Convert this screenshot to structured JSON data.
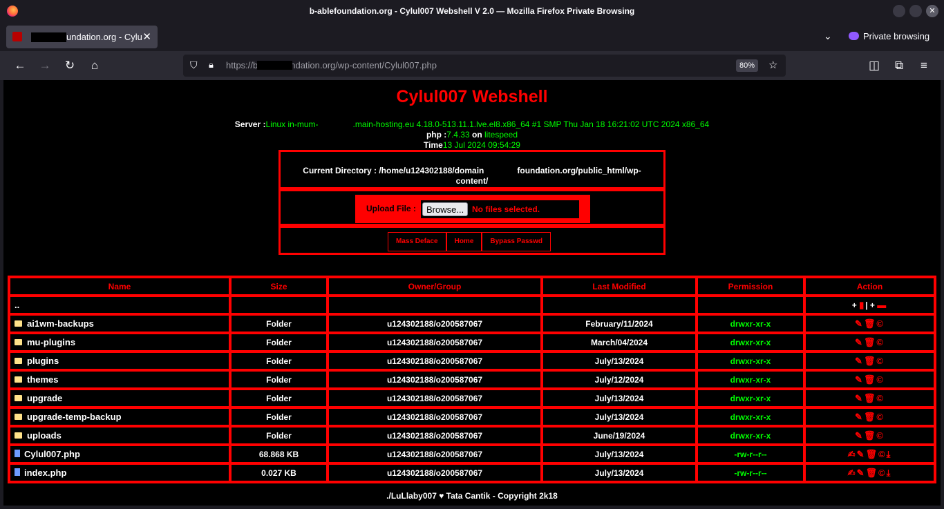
{
  "window": {
    "title": "b-ablefoundation.org - Cylul007 Webshell V 2.0 — Mozilla Firefox Private Browsing"
  },
  "tab": {
    "title": "undation.org - Cylul"
  },
  "tabbar": {
    "private_label": "Private browsing"
  },
  "navbar": {
    "url_prefix": "https://",
    "url_rest": "b-ablefoundation.org/wp-content/Cylul007.php",
    "zoom": "80%"
  },
  "page": {
    "heading": "Cylul007 Webshell",
    "server_label": "Server :",
    "server_part1": "Linux in-mum-",
    "server_part2": ".main-hosting.eu 4.18.0-513.11.1.lve.el8.x86_64 #1 SMP Thu Jan 18 16:21:02 UTC 2024 x86_64",
    "php_label": "php :",
    "php_version": "7.4.33",
    "on_label": " on ",
    "server_software": "litespeed",
    "time_label": "Time",
    "time_value": "13 Jul 2024 09:54:29",
    "curdir_label": "Current Directory : /home/u124302188/domain",
    "curdir_rest": "foundation.org/public_html/wp-",
    "curdir_line2": "content/",
    "upload_label": "Upload File :",
    "browse_label": "Browse...",
    "no_file": "No files selected.",
    "links": [
      "Mass Deface",
      "Home",
      "Bypass Passwd"
    ],
    "footer": "./LuLlaby007 ♥ Tata Cantik - Copyright 2k18"
  },
  "table": {
    "headers": [
      "Name",
      "Size",
      "Owner/Group",
      "Last Modified",
      "Permission",
      "Action"
    ],
    "parent": "..",
    "parent_action": "+ 🗎 | + 🗀",
    "rows": [
      {
        "name": "ai1wm-backups",
        "size": "Folder",
        "owner": "u124302188/o200587067",
        "modified": "February/11/2024",
        "perm": "drwxr-xr-x",
        "type": "folder"
      },
      {
        "name": "mu-plugins",
        "size": "Folder",
        "owner": "u124302188/o200587067",
        "modified": "March/04/2024",
        "perm": "drwxr-xr-x",
        "type": "folder"
      },
      {
        "name": "plugins",
        "size": "Folder",
        "owner": "u124302188/o200587067",
        "modified": "July/13/2024",
        "perm": "drwxr-xr-x",
        "type": "folder"
      },
      {
        "name": "themes",
        "size": "Folder",
        "owner": "u124302188/o200587067",
        "modified": "July/12/2024",
        "perm": "drwxr-xr-x",
        "type": "folder"
      },
      {
        "name": "upgrade",
        "size": "Folder",
        "owner": "u124302188/o200587067",
        "modified": "July/13/2024",
        "perm": "drwxr-xr-x",
        "type": "folder"
      },
      {
        "name": "upgrade-temp-backup",
        "size": "Folder",
        "owner": "u124302188/o200587067",
        "modified": "July/13/2024",
        "perm": "drwxr-xr-x",
        "type": "folder"
      },
      {
        "name": "uploads",
        "size": "Folder",
        "owner": "u124302188/o200587067",
        "modified": "June/19/2024",
        "perm": "drwxr-xr-x",
        "type": "folder"
      },
      {
        "name": "Cylul007.php",
        "size": "68.868 KB",
        "owner": "u124302188/o200587067",
        "modified": "July/13/2024",
        "perm": "-rw-r--r--",
        "type": "file"
      },
      {
        "name": "index.php",
        "size": "0.027 KB",
        "owner": "u124302188/o200587067",
        "modified": "July/13/2024",
        "perm": "-rw-r--r--",
        "type": "file"
      }
    ]
  },
  "colors": {
    "accent": "#ff0000",
    "perm": "#00ff00"
  }
}
